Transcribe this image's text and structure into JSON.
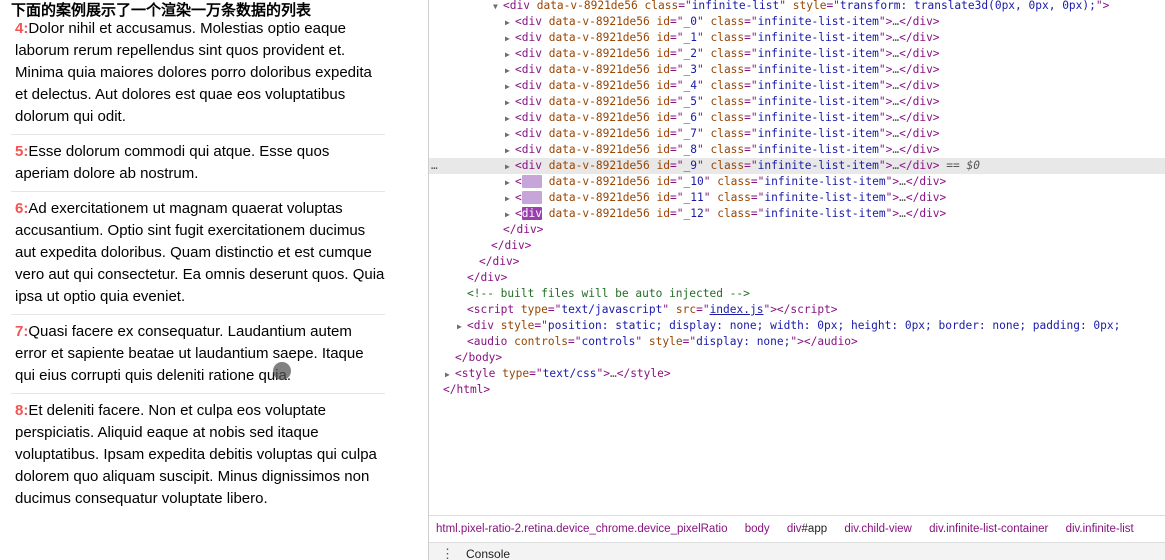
{
  "page": {
    "title": "下面的案例展示了一个渲染一万条数据的列表",
    "items": [
      {
        "num": "4:",
        "text": "Dolor nihil et accusamus. Molestias optio eaque laborum rerum repellendus sint quos provident et. Minima quia maiores dolores porro doloribus expedita et delectus. Aut dolores est quae eos voluptatibus dolorum qui odit."
      },
      {
        "num": "5:",
        "text": "Esse dolorum commodi qui atque. Esse quos aperiam dolore ab nostrum."
      },
      {
        "num": "6:",
        "text": "Ad exercitationem ut magnam quaerat voluptas accusantium. Optio sint fugit exercitationem ducimus aut expedita doloribus. Quam distinctio et est cumque vero aut qui consectetur. Ea omnis deserunt quos. Quia ipsa ut optio quia eveniet."
      },
      {
        "num": "7:",
        "text": "Quasi facere ex consequatur. Laudantium autem error et sapiente beatae ut laudantium saepe. Itaque qui eius corrupti quis deleniti ratione quia."
      },
      {
        "num": "8:",
        "text": "Et deleniti facere. Non et culpa eos voluptate perspiciatis. Aliquid eaque at nobis sed itaque voluptatibus. Ipsam expedita debitis voluptas qui culpa dolorem quo aliquam suscipit. Minus dignissimos non ducimus consequatur voluptate libero."
      }
    ]
  },
  "devtools": {
    "container": {
      "tag": "div",
      "attr_v": "data-v-8921de56",
      "class_attr": "class",
      "class_val": "infinite-list",
      "style_attr": "style",
      "style_val": "transform: translate3d(0px, 0px, 0px);"
    },
    "list_items": [
      {
        "id": "_0"
      },
      {
        "id": "_1"
      },
      {
        "id": "_2"
      },
      {
        "id": "_3"
      },
      {
        "id": "_4"
      },
      {
        "id": "_5"
      },
      {
        "id": "_6"
      },
      {
        "id": "_7"
      },
      {
        "id": "_8"
      },
      {
        "id": "_9"
      },
      {
        "id": "_10"
      },
      {
        "id": "_11"
      },
      {
        "id": "_12"
      }
    ],
    "item_attr_v": "data-v-8921de56",
    "item_class": "infinite-list-item",
    "selected_suffix": "== $0",
    "comment": "<!-- built files will be auto injected -->",
    "script_type": "text/javascript",
    "script_src": "index.js",
    "hidden_div_style": "position: static; display: none; width: 0px; height: 0px; border: none; padding: 0px;",
    "audio_controls": "controls",
    "audio_style": "display: none;",
    "style_type": "text/css",
    "close_div": "</div>",
    "close_body": "</body>",
    "close_html": "</html>",
    "ellipsis": "…",
    "dots": "…",
    "breadcrumbs": [
      {
        "label": "html.pixel-ratio-2.retina.device_chrome.device_pixelRatio"
      },
      {
        "label": "body"
      },
      {
        "label": "div",
        "suffix": "#app"
      },
      {
        "label": "div.child-view"
      },
      {
        "label": "div.infinite-list-container"
      },
      {
        "label": "div.infinite-list"
      }
    ],
    "drawer_tab": "Console"
  }
}
